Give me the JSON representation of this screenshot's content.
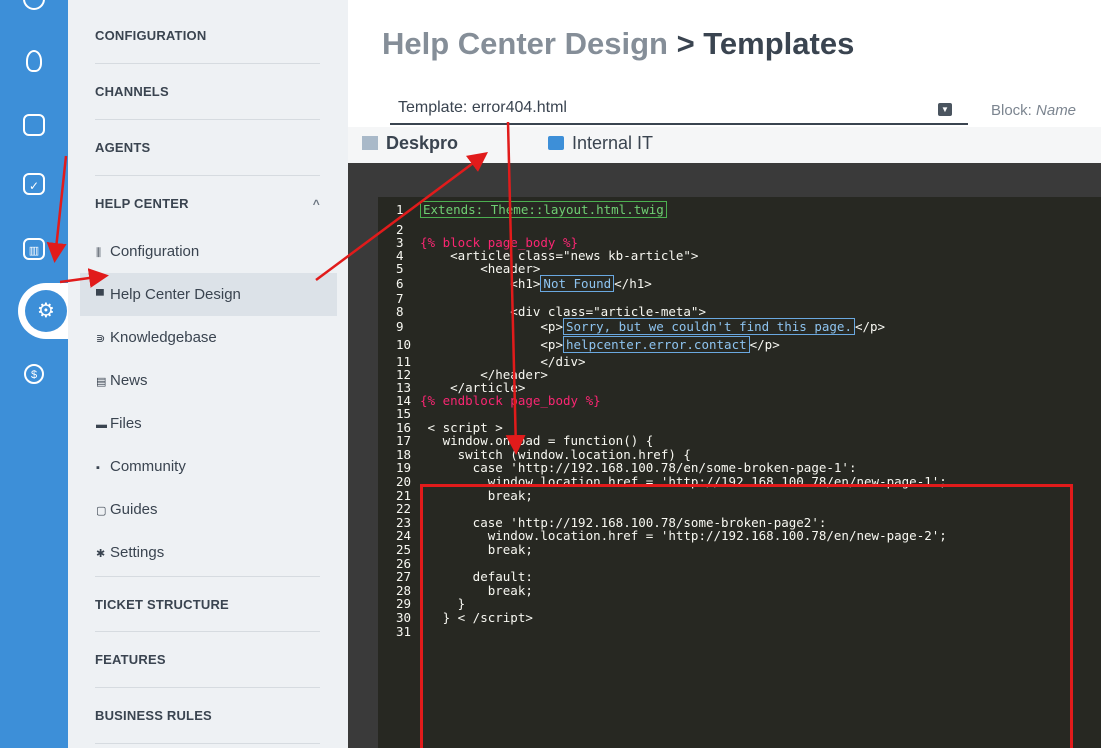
{
  "rail": {
    "icons": [
      "chat-icon",
      "user-icon",
      "ticket-search-icon",
      "task-check-icon",
      "reports-icon",
      "settings-gear-icon",
      "billing-dollar-icon"
    ]
  },
  "nav": {
    "sections": {
      "configuration": "CONFIGURATION",
      "channels": "CHANNELS",
      "agents": "AGENTS",
      "help_center": "HELP CENTER",
      "ticket_structure": "TICKET STRUCTURE",
      "features": "FEATURES",
      "business_rules": "BUSINESS RULES"
    },
    "help_center_caret": "^",
    "items": [
      {
        "label": "Configuration",
        "icon": "sliders-icon",
        "glyph": "⫼"
      },
      {
        "label": "Help Center Design",
        "icon": "book-icon",
        "glyph": "▀"
      },
      {
        "label": "Knowledgebase",
        "icon": "graduation-icon",
        "glyph": "⋑"
      },
      {
        "label": "News",
        "icon": "newspaper-icon",
        "glyph": "▤"
      },
      {
        "label": "Files",
        "icon": "folder-icon",
        "glyph": "▬"
      },
      {
        "label": "Community",
        "icon": "comments-icon",
        "glyph": "▪"
      },
      {
        "label": "Guides",
        "icon": "guide-icon",
        "glyph": "▢"
      },
      {
        "label": "Settings",
        "icon": "cog-icon",
        "glyph": "✱"
      }
    ],
    "active_item": "Help Center Design"
  },
  "header": {
    "crumb_parent": "Help Center Design",
    "crumb_sep": " > ",
    "crumb_leaf": "Templates"
  },
  "template_select": {
    "value": "Template: error404.html"
  },
  "block_select": {
    "label": "Block: ",
    "placeholder": "Name"
  },
  "tabs": [
    {
      "label": "Deskpro"
    },
    {
      "label": "Internal IT"
    }
  ],
  "code": {
    "lines": [
      {
        "n": "1",
        "t": "",
        "special": "extends",
        "box": "Extends: Theme::layout.html.twig"
      },
      {
        "n": "2",
        "t": ""
      },
      {
        "n": "3",
        "t": "{% block page_body %}",
        "special": "twig"
      },
      {
        "n": "4",
        "t": "    <article class=\"news kb-article\">"
      },
      {
        "n": "5",
        "t": "        <header>"
      },
      {
        "n": "6",
        "t": "            <h1>",
        "special": "boxed",
        "box": "Not Found",
        "after": "</h1>"
      },
      {
        "n": "7",
        "t": ""
      },
      {
        "n": "8",
        "t": "            <div class=\"article-meta\">"
      },
      {
        "n": "9",
        "t": "                <p>",
        "special": "boxed",
        "box": "Sorry, but we couldn't find this page.",
        "after": "</p>"
      },
      {
        "n": "10",
        "t": "                <p>",
        "special": "boxed",
        "box": "helpcenter.error.contact",
        "after": "</p>"
      },
      {
        "n": "11",
        "t": "                </div>"
      },
      {
        "n": "12",
        "t": "        </header>"
      },
      {
        "n": "13",
        "t": "    </article>"
      },
      {
        "n": "14",
        "t": "{% endblock page_body %}",
        "special": "twig"
      },
      {
        "n": "15",
        "t": ""
      },
      {
        "n": "16",
        "t": " < script >"
      },
      {
        "n": "17",
        "t": "   window.onload = function() {"
      },
      {
        "n": "18",
        "t": "     switch (window.location.href) {"
      },
      {
        "n": "19",
        "t": "       case 'http://192.168.100.78/en/some-broken-page-1':"
      },
      {
        "n": "20",
        "t": "         window.location.href = 'http://192.168.100.78/en/new-page-1';"
      },
      {
        "n": "21",
        "t": "         break;"
      },
      {
        "n": "22",
        "t": ""
      },
      {
        "n": "23",
        "t": "       case 'http://192.168.100.78/some-broken-page2':"
      },
      {
        "n": "24",
        "t": "         window.location.href = 'http://192.168.100.78/en/new-page-2';"
      },
      {
        "n": "25",
        "t": "         break;"
      },
      {
        "n": "26",
        "t": ""
      },
      {
        "n": "27",
        "t": "       default:"
      },
      {
        "n": "28",
        "t": "         break;"
      },
      {
        "n": "29",
        "t": "     }"
      },
      {
        "n": "30",
        "t": "   } < /script>"
      },
      {
        "n": "31",
        "t": ""
      }
    ]
  },
  "colors": {
    "rail": "#3d8fd8",
    "annotation": "#e11b1b",
    "editor_bg": "#272822"
  }
}
